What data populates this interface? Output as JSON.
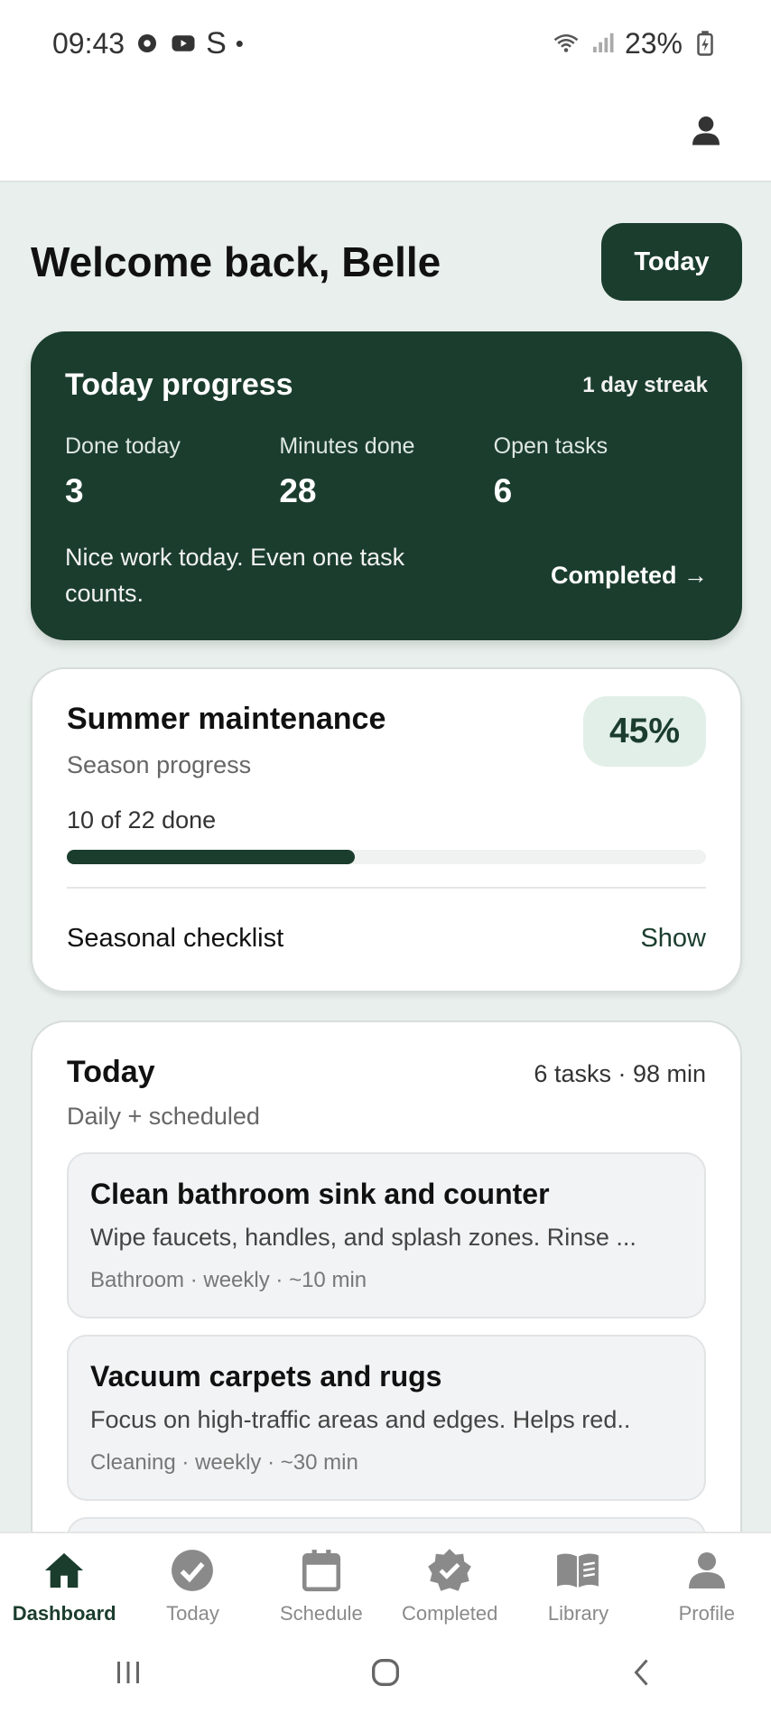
{
  "status_bar": {
    "time": "09:43",
    "left_icons": [
      "settings-icon",
      "youtube-icon",
      "s-app-icon",
      "dot-icon"
    ],
    "battery": "23%",
    "right_icons": [
      "wifi-icon",
      "signal-icon",
      "battery-charging-icon"
    ]
  },
  "header": {
    "welcome": "Welcome back, Belle",
    "today_button": "Today",
    "profile_icon": "person-icon"
  },
  "progress_card": {
    "title": "Today progress",
    "streak": "1 day streak",
    "stats": [
      {
        "label": "Done today",
        "value": "3"
      },
      {
        "label": "Minutes done",
        "value": "28"
      },
      {
        "label": "Open tasks",
        "value": "6"
      }
    ],
    "message": "Nice work today. Even one task counts.",
    "link": "Completed →"
  },
  "season_card": {
    "title": "Summer maintenance",
    "subtitle": "Season progress",
    "count": "10 of 22 done",
    "percent_label": "45%",
    "progress_fraction": 0.45,
    "checklist_label": "Seasonal checklist",
    "show_label": "Show"
  },
  "today_card": {
    "title": "Today",
    "meta": "6 tasks · 98 min",
    "subtitle": "Daily + scheduled",
    "tasks": [
      {
        "title": "Clean bathroom sink and counter",
        "desc": "Wipe faucets, handles, and splash zones. Rinse ...",
        "meta": "Bathroom · weekly · ~10 min"
      },
      {
        "title": "Vacuum carpets and rugs",
        "desc": "Focus on high-traffic areas and edges. Helps red..",
        "meta": "Cleaning · weekly · ~30 min"
      }
    ]
  },
  "bottom_nav": {
    "items": [
      {
        "label": "Dashboard",
        "icon": "home-icon",
        "active": true
      },
      {
        "label": "Today",
        "icon": "check-circle-icon",
        "active": false
      },
      {
        "label": "Schedule",
        "icon": "calendar-icon",
        "active": false
      },
      {
        "label": "Completed",
        "icon": "verified-badge-icon",
        "active": false
      },
      {
        "label": "Library",
        "icon": "book-icon",
        "active": false
      },
      {
        "label": "Profile",
        "icon": "person-icon",
        "active": false
      }
    ]
  },
  "system_nav": [
    "recents-icon",
    "home-circle-icon",
    "back-icon"
  ],
  "colors": {
    "accent": "#1b3d2e",
    "background": "#e8efec",
    "badge_bg": "#e2efe9"
  }
}
